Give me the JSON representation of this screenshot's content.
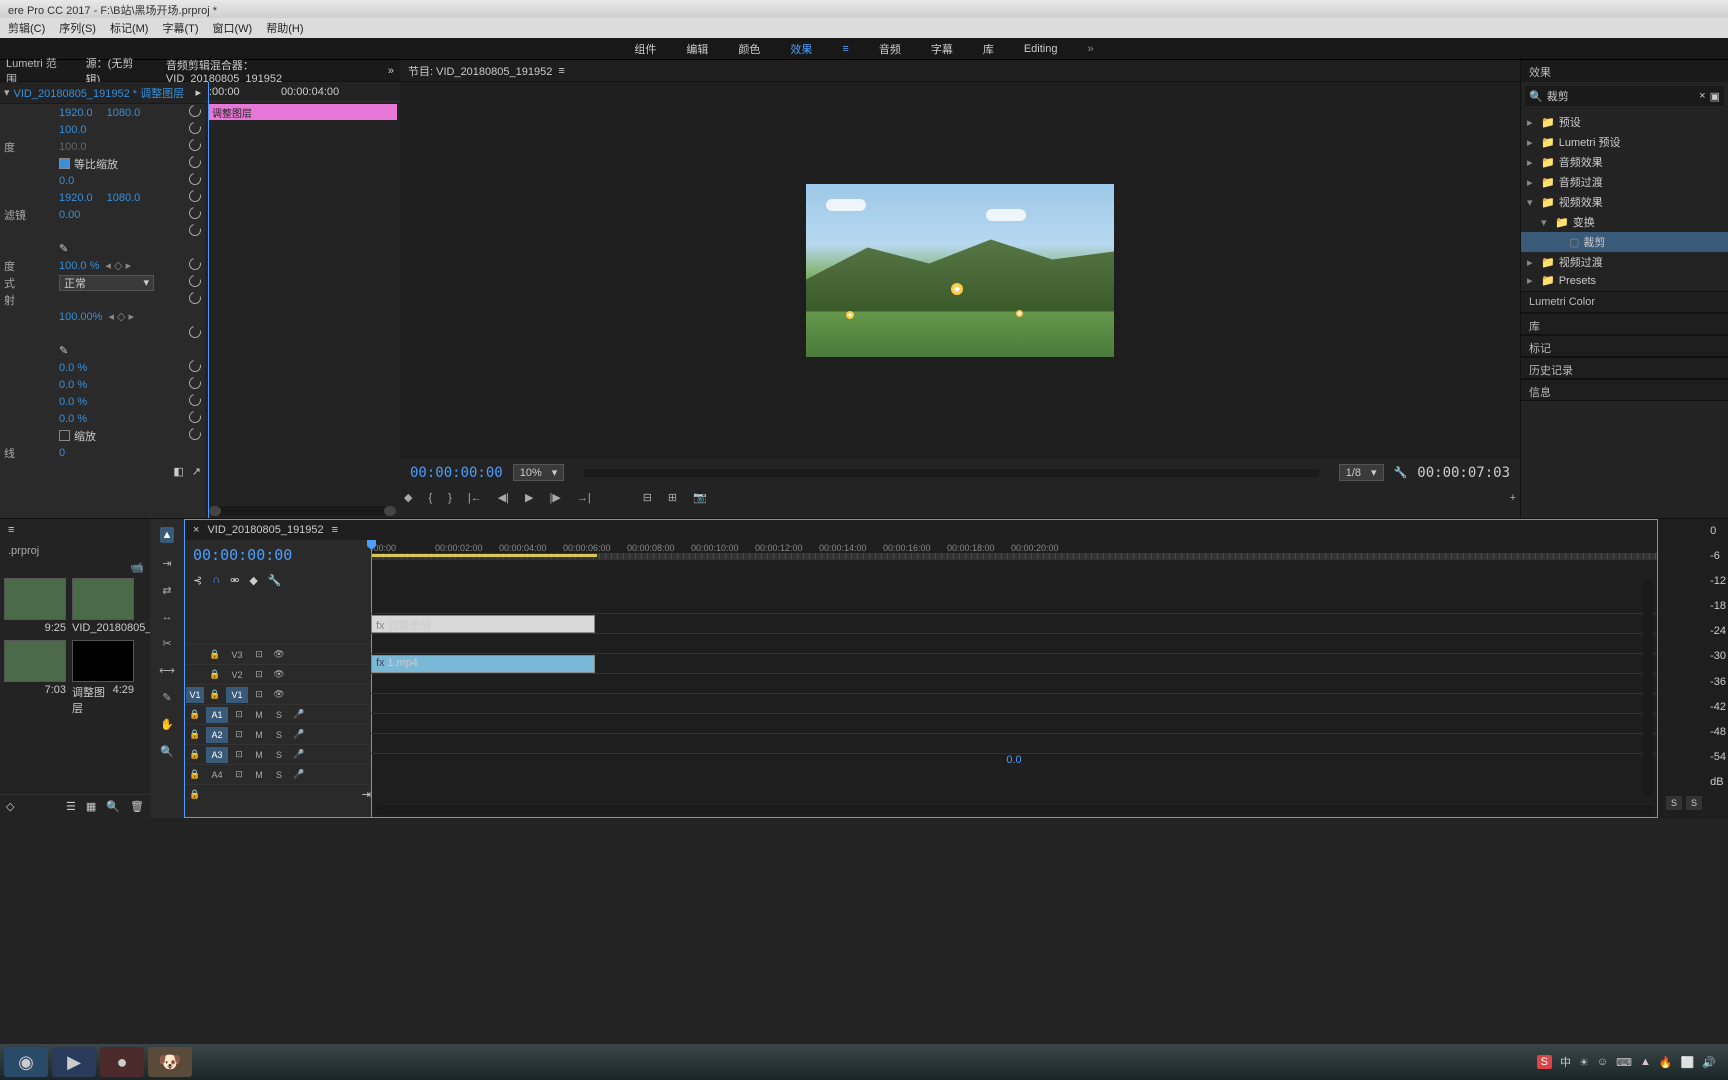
{
  "title": "ere Pro CC 2017 - F:\\B站\\黑场开场.prproj *",
  "menu": [
    "剪辑(C)",
    "序列(S)",
    "标记(M)",
    "字幕(T)",
    "窗口(W)",
    "帮助(H)"
  ],
  "workspaces": {
    "items": [
      "组件",
      "编辑",
      "颜色",
      "效果",
      "音频",
      "字幕",
      "库",
      "Editing"
    ],
    "active": "效果"
  },
  "panels_top": {
    "lumetri": "Lumetri 范围",
    "source": "源：(无剪辑)",
    "audio_mixer": "音频剪辑混合器：VID_20180805_191952"
  },
  "effect_controls": {
    "clip_name": "VID_20180805_191952 * 调整图层",
    "timeline_clip": "调整图层",
    "ruler": {
      "t0": ":00:00",
      "t1": "00:00:04:00"
    },
    "props": [
      {
        "lbl": "",
        "v1": "1920.0",
        "v2": "1080.0",
        "reset": true
      },
      {
        "lbl": "",
        "v1": "100.0",
        "reset": true
      },
      {
        "lbl": "度",
        "v1": "100.0",
        "dim": true,
        "reset": true
      },
      {
        "lbl": "",
        "check": true,
        "checklbl": "等比缩放",
        "reset": true
      },
      {
        "lbl": "",
        "v1": "0.0",
        "reset": true
      },
      {
        "lbl": "",
        "v1": "1920.0",
        "v2": "1080.0",
        "reset": true
      },
      {
        "lbl": "滤镜",
        "v1": "0.00",
        "reset": true
      },
      {
        "lbl": "",
        "reset": true
      },
      {
        "lbl": "",
        "pen": true
      },
      {
        "lbl": "度",
        "v1": "100.0 %",
        "nav": true,
        "reset": true
      },
      {
        "lbl": "式",
        "dd": "正常",
        "reset": true
      },
      {
        "lbl": "射",
        "reset": true
      },
      {
        "lbl": "",
        "v1": "100.00%",
        "nav": true
      },
      {
        "lbl": "",
        "reset": true
      },
      {
        "lbl": "",
        "pen": true
      },
      {
        "lbl": "",
        "v1": "0.0 %",
        "reset": true
      },
      {
        "lbl": "",
        "v1": "0.0 %",
        "reset": true
      },
      {
        "lbl": "",
        "v1": "0.0 %",
        "reset": true
      },
      {
        "lbl": "",
        "v1": "0.0 %",
        "reset": true
      },
      {
        "lbl": "",
        "check": false,
        "checklbl": "缩放",
        "reset": true
      },
      {
        "lbl": "线",
        "v1": "0"
      }
    ]
  },
  "program": {
    "title": "节目: VID_20180805_191952",
    "time_in": "00:00:00:00",
    "zoom": "10%",
    "quality": "1/8",
    "time_out": "00:00:07:03"
  },
  "effects_panel": {
    "title": "效果",
    "search": "裁剪",
    "tree": [
      {
        "lvl": 0,
        "chev": "▸",
        "icon": "folder",
        "name": "预设"
      },
      {
        "lvl": 0,
        "chev": "▸",
        "icon": "folder",
        "name": "Lumetri 预设"
      },
      {
        "lvl": 0,
        "chev": "▸",
        "icon": "folder",
        "name": "音频效果"
      },
      {
        "lvl": 0,
        "chev": "▸",
        "icon": "folder",
        "name": "音频过渡"
      },
      {
        "lvl": 0,
        "chev": "▾",
        "icon": "folder",
        "name": "视频效果"
      },
      {
        "lvl": 1,
        "chev": "▾",
        "icon": "folder",
        "name": "变换"
      },
      {
        "lvl": 2,
        "chev": "",
        "icon": "fx",
        "name": "裁剪",
        "hl": true
      },
      {
        "lvl": 0,
        "chev": "▸",
        "icon": "folder",
        "name": "视频过渡"
      },
      {
        "lvl": 0,
        "chev": "▸",
        "icon": "folder",
        "name": "Presets"
      }
    ],
    "sections": [
      "Lumetri Color",
      "库",
      "标记",
      "历史记录",
      "信息"
    ]
  },
  "project": {
    "name": ".prproj",
    "items": [
      {
        "thumb": "video",
        "name": "",
        "dur": "9:25"
      },
      {
        "thumb": "video",
        "name": "VID_20180805_...",
        "dur": "7:03"
      },
      {
        "thumb": "video",
        "name": "",
        "dur": "7:03"
      },
      {
        "thumb": "black",
        "name": "调整图层",
        "dur": "4:29"
      }
    ]
  },
  "timeline": {
    "seq_name": "VID_20180805_191952",
    "time": "00:00:00:00",
    "ruler": [
      ":00:00",
      "00:00:02:00",
      "00:00:04:00",
      "00:00:06:00",
      "00:00:08:00",
      "00:00:10:00",
      "00:00:12:00",
      "00:00:14:00",
      "00:00:16:00",
      "00:00:18:00",
      "00:00:20:00"
    ],
    "tracks": {
      "video": [
        "V3",
        "V2",
        "V1"
      ],
      "audio": [
        "A1",
        "A2",
        "A3",
        "A4"
      ]
    },
    "clips": {
      "adj": "调整图层",
      "vid": "1.mp4"
    },
    "master_vol": "0.0"
  },
  "meter": {
    "scale": [
      "0",
      "-6",
      "-12",
      "-18",
      "-24",
      "-30",
      "-36",
      "-42",
      "-48",
      "-54",
      "dB"
    ],
    "btns": [
      "S",
      "S"
    ]
  },
  "systray": {
    "ime": "中"
  }
}
